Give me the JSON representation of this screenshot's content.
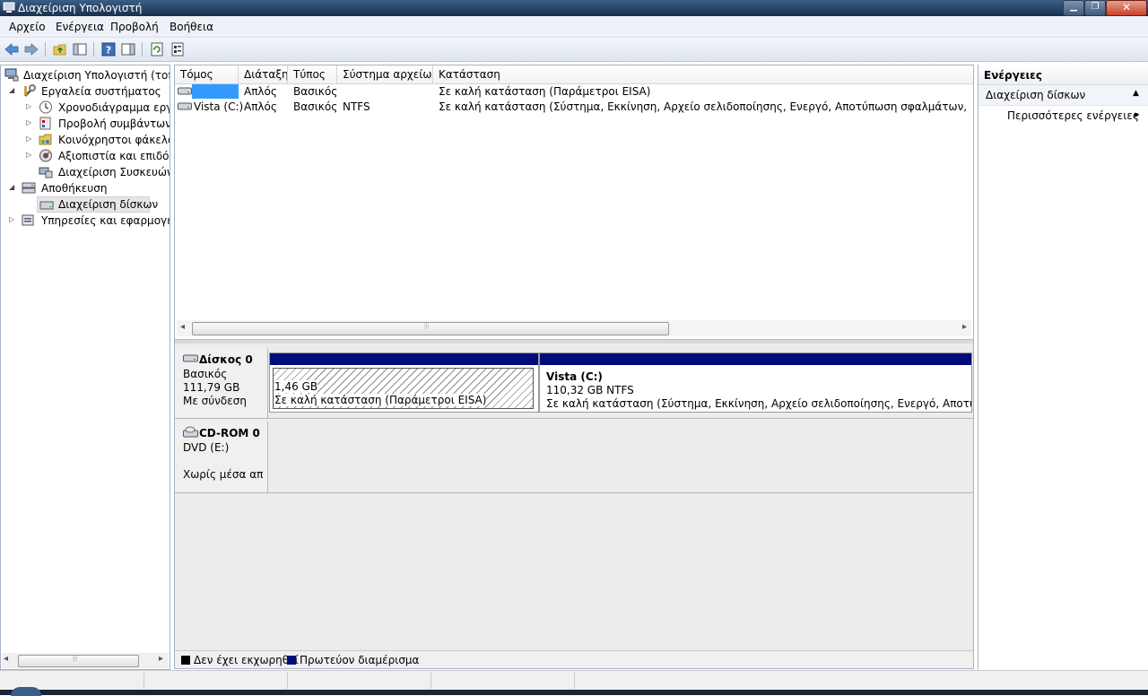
{
  "window": {
    "title": "Διαχείριση Υπολογιστή",
    "min_glyph": "▁",
    "max_glyph": "❐",
    "close_glyph": "✕"
  },
  "menu": [
    "Αρχείο",
    "Ενέργεια",
    "Προβολή",
    "Βοήθεια"
  ],
  "toolbar": {
    "icons": [
      "back-arrow-icon",
      "forward-arrow-icon",
      "folder-up-icon",
      "show-hide-tree-icon",
      "help-icon",
      "show-hide-action-pane-icon",
      "refresh-icon",
      "properties-icon"
    ]
  },
  "tree": {
    "root": "Διαχείριση Υπολογιστή (τοπικός)",
    "system_tools": "Εργαλεία συστήματος",
    "task_scheduler": "Χρονοδιάγραμμα εργασιών",
    "event_viewer": "Προβολή συμβάντων",
    "shared_folders": "Κοινόχρηστοι φάκελοι",
    "reliability": "Αξιοπιστία και επιδόσεις",
    "device_manager": "Διαχείριση Συσκευών",
    "storage": "Αποθήκευση",
    "disk_management": "Διαχείριση δίσκων",
    "services": "Υπηρεσίες και εφαρμογές",
    "expand_glyph": "▷",
    "collapse_glyph": "◢"
  },
  "volume_list": {
    "columns": [
      "Τόμος",
      "Διάταξη",
      "Τύπος",
      "Σύστημα αρχείων",
      "Κατάσταση"
    ],
    "rows": [
      {
        "volume": "",
        "layout": "Απλός",
        "type": "Βασικός",
        "fs": "",
        "status": "Σε καλή κατάσταση (Παράμετροι EISA)"
      },
      {
        "volume": "Vista (C:)",
        "layout": "Απλός",
        "type": "Βασικός",
        "fs": "NTFS",
        "status": "Σε καλή κατάσταση (Σύστημα, Εκκίνηση, Αρχείο σελιδοποίησης, Ενεργό, Αποτύπωση σφαλμάτων, Πρωτεύον διαμέρισμα)"
      }
    ],
    "scroll_left": "◂",
    "scroll_right": "▸",
    "thumb_grip": "⦙⦙⦙"
  },
  "disks": {
    "disk0": {
      "name": "Δίσκος 0",
      "type": "Βασικός",
      "size": "111,79 GB",
      "state": "Με σύνδεση"
    },
    "partitions": [
      {
        "label": "",
        "size": "1,46 GB",
        "status": "Σε καλή κατάσταση (Παράμετροι EISA)"
      },
      {
        "label": "Vista  (C:)",
        "size": "110,32 GB NTFS",
        "status": "Σε καλή κατάσταση (Σύστημα, Εκκίνηση, Αρχείο σελιδοποίησης, Ενεργό, Αποτύπωση σφαλμάτων, Πρωτεύον διαμέρισμα)"
      }
    ],
    "cdrom0": {
      "name": "CD-ROM 0",
      "drive": "DVD (E:)",
      "state": "Χωρίς μέσα αποθήκευσης"
    }
  },
  "legend": {
    "unallocated": "Δεν έχει εκχωρηθεί",
    "primary": "Πρωτεύον διαμέρισμα",
    "unallocated_color": "#000000",
    "primary_color": "#000c7a"
  },
  "actions": {
    "header": "Ενέργειες",
    "section": "Διαχείριση δίσκων",
    "more": "Περισσότερες ενέργειες",
    "section_glyph": "▲",
    "more_glyph": "▸"
  }
}
